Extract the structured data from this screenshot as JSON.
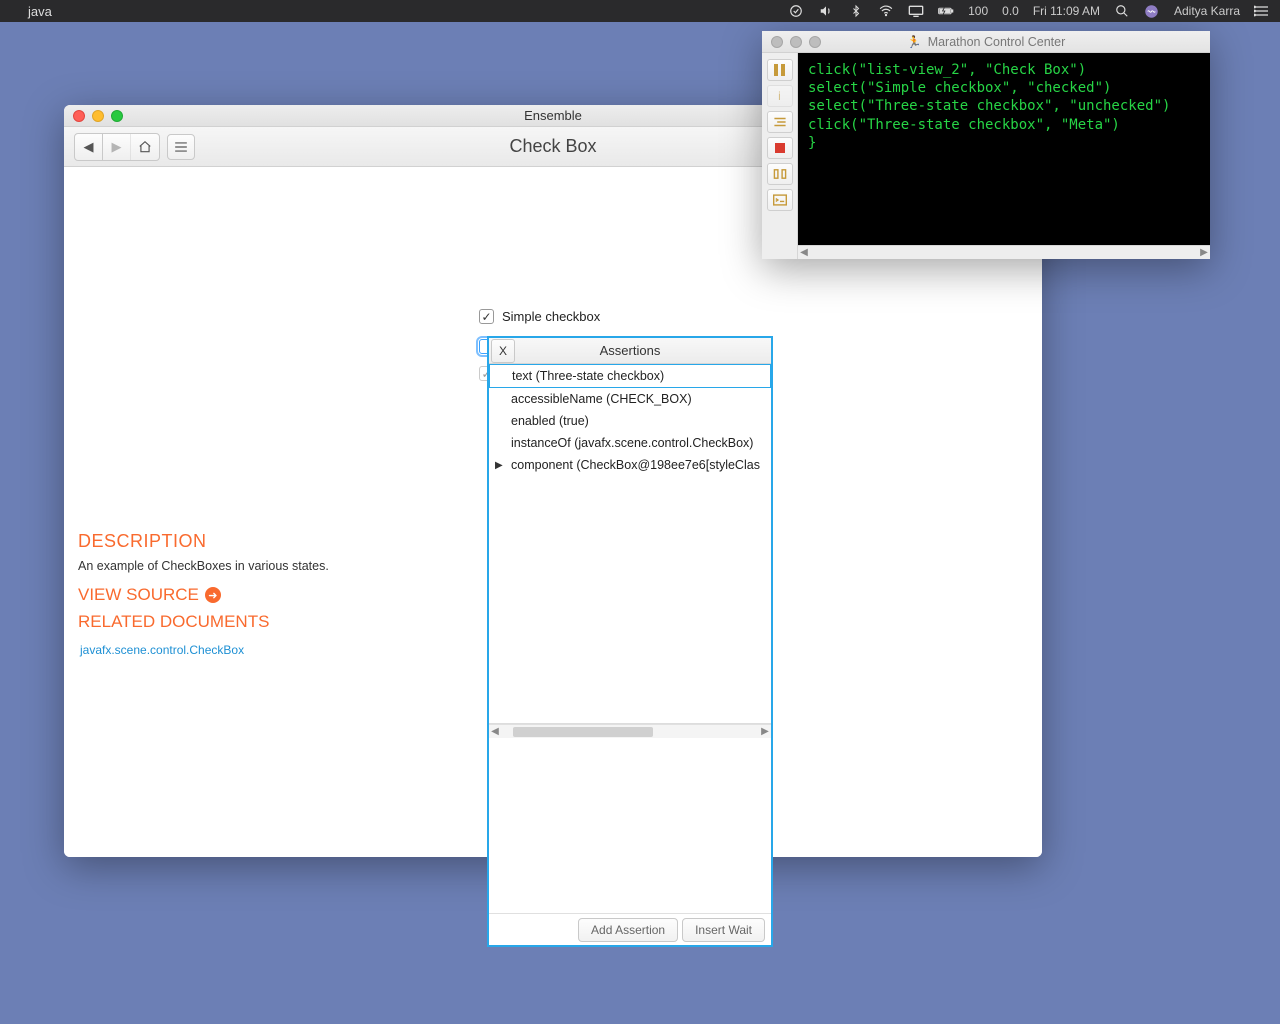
{
  "menubar": {
    "app": "java",
    "battery": "100",
    "cpu": "0.0",
    "clock": "Fri 11:09 AM",
    "user": "Aditya Karra"
  },
  "ensemble": {
    "title": "Ensemble",
    "heading": "Check Box",
    "simple_checkbox": "Simple checkbox",
    "description_heading": "DESCRIPTION",
    "description_text": "An example of CheckBoxes in various states.",
    "view_source": "VIEW SOURCE",
    "related": "RELATED DOCUMENTS",
    "api_link": "javafx.scene.control.CheckBox"
  },
  "assertions": {
    "title": "Assertions",
    "close": "X",
    "items": [
      "text (Three-state checkbox)",
      "accessibleName (CHECK_BOX)",
      "enabled (true)",
      "instanceOf (javafx.scene.control.CheckBox)",
      "component (CheckBox@198ee7e6[styleClas"
    ],
    "add_btn": "Add Assertion",
    "wait_btn": "Insert Wait"
  },
  "marathon": {
    "title": "Marathon Control Center",
    "code": "click(\"list-view_2\", \"Check Box\")\nselect(\"Simple checkbox\", \"checked\")\nselect(\"Three-state checkbox\", \"unchecked\")\nclick(\"Three-state checkbox\", \"Meta\")\n}"
  }
}
